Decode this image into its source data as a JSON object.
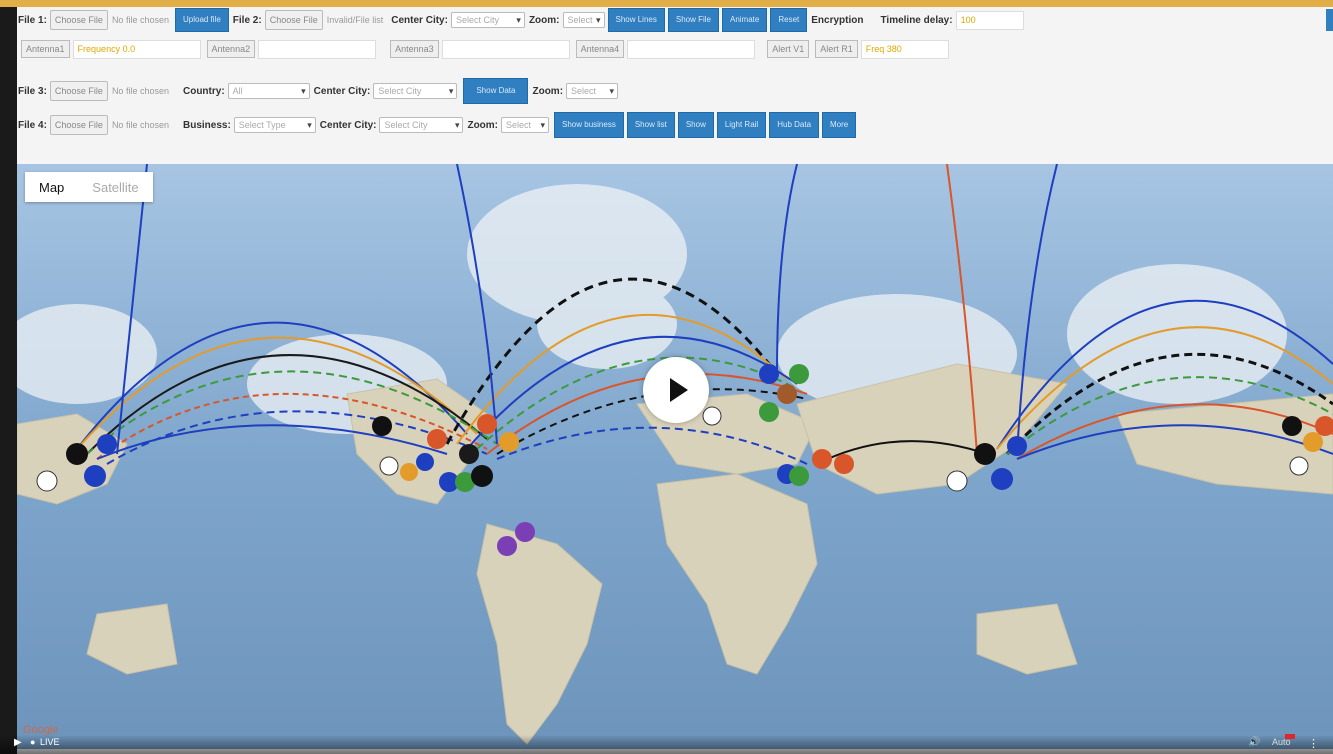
{
  "toolbar1": {
    "file1_label": "File 1:",
    "choose_file": "Choose File",
    "no_file": "No file chosen",
    "upload_btn": "Upload file",
    "file2_label": "File 2:",
    "file2_status": "Invalid/File list",
    "center_city_label": "Center City:",
    "center_city_value": "Select City",
    "zoom_label": "Zoom:",
    "zoom_value": "Select",
    "buttons": [
      "Show Lines",
      "Show File",
      "Animate",
      "Reset"
    ],
    "encryption_label": "Encryption",
    "timeline_label": "Timeline delay:",
    "timeline_value": "100"
  },
  "toolbar2": {
    "antenna1_label": "Antenna1",
    "antenna1_value": "Frequency 0.0",
    "antenna2_label": "Antenna2",
    "antenna3_label": "Antenna3",
    "antenna4_label": "Antenna4",
    "alert1_label": "Alert V1",
    "alert2_label": "Alert R1",
    "alert_value": "Freq 380"
  },
  "toolbar3": {
    "file3_label": "File 3:",
    "choose_file": "Choose File",
    "no_file": "No file chosen",
    "country_label": "Country:",
    "country_value": "All",
    "center_city_label": "Center City:",
    "center_city_value": "Select City",
    "show_btn": "Show Data",
    "zoom_label": "Zoom:",
    "zoom_value": "Select"
  },
  "toolbar4": {
    "file4_label": "File 4:",
    "choose_file": "Choose File",
    "no_file": "No file chosen",
    "business_label": "Business:",
    "business_value": "Select Type",
    "center_city_label": "Center City:",
    "center_city_value": "Select City",
    "zoom_label": "Zoom:",
    "zoom_value": "Select",
    "buttons": [
      "Show business",
      "Show list",
      "Show",
      "Light Rail",
      "Hub Data",
      "More"
    ]
  },
  "map": {
    "toggle_map": "Map",
    "toggle_satellite": "Satellite",
    "watermark": "Google"
  },
  "player": {
    "live_label": "LIVE",
    "quality": "Auto"
  },
  "colors": {
    "accent": "#2f7fc1",
    "ocean": "#8fb0cf",
    "land": "#d7d0b8"
  }
}
